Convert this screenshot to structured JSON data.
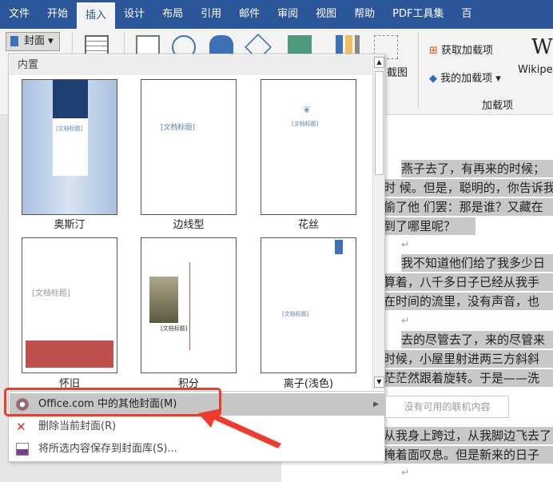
{
  "tabs": [
    "文件",
    "开始",
    "插入",
    "设计",
    "布局",
    "引用",
    "邮件",
    "审阅",
    "视图",
    "帮助",
    "PDF工具集",
    "百"
  ],
  "active_tab": "插入",
  "ribbon": {
    "cover_label": "封面",
    "screenshot_label": "截图",
    "get_addins": "获取加载项",
    "my_addins": "我的加载项",
    "wiki": "W",
    "wiki_label": "Wikipe",
    "group_addins": "加载项"
  },
  "menu": {
    "header": "内置",
    "thumbnails": [
      {
        "label": "奥斯汀",
        "title": "[文档标题]"
      },
      {
        "label": "边线型",
        "title": "[文档标题]"
      },
      {
        "label": "花丝",
        "title": "[文档标题]"
      },
      {
        "label": "怀旧",
        "title": "[文档标题]"
      },
      {
        "label": "积分",
        "title": "[文档标题]"
      },
      {
        "label": "离子(浅色)",
        "title": "[文档标题]"
      }
    ],
    "items": [
      {
        "label": "Office.com 中的其他封面(M)"
      },
      {
        "label": "删除当前封面(R)"
      },
      {
        "label": "将所选内容保存到封面库(S)..."
      }
    ],
    "submenu": "没有可用的联机内容"
  },
  "document": {
    "lines": [
      "燕子去了，有再来的时候；",
      "时 候。但是，聪明的，你告诉我",
      "偷了他 们罢：那是谁？又藏在",
      "到了哪里呢？",
      "我不知道他们给了我多少日",
      "算着，八千多日子已经从我手",
      "在时间的流里，没有声音，也",
      "去的尽管去了，来的尽管来",
      "时候，小屋里射进两三方斜斜",
      "茫茫然跟着旋转。于是——洗",
      "从我身上跨过，从我脚边飞去了",
      "掩着面叹息。但是新来的日子"
    ]
  },
  "colors": {
    "accent": "#2b579a",
    "highlight": "#f03b2c"
  }
}
